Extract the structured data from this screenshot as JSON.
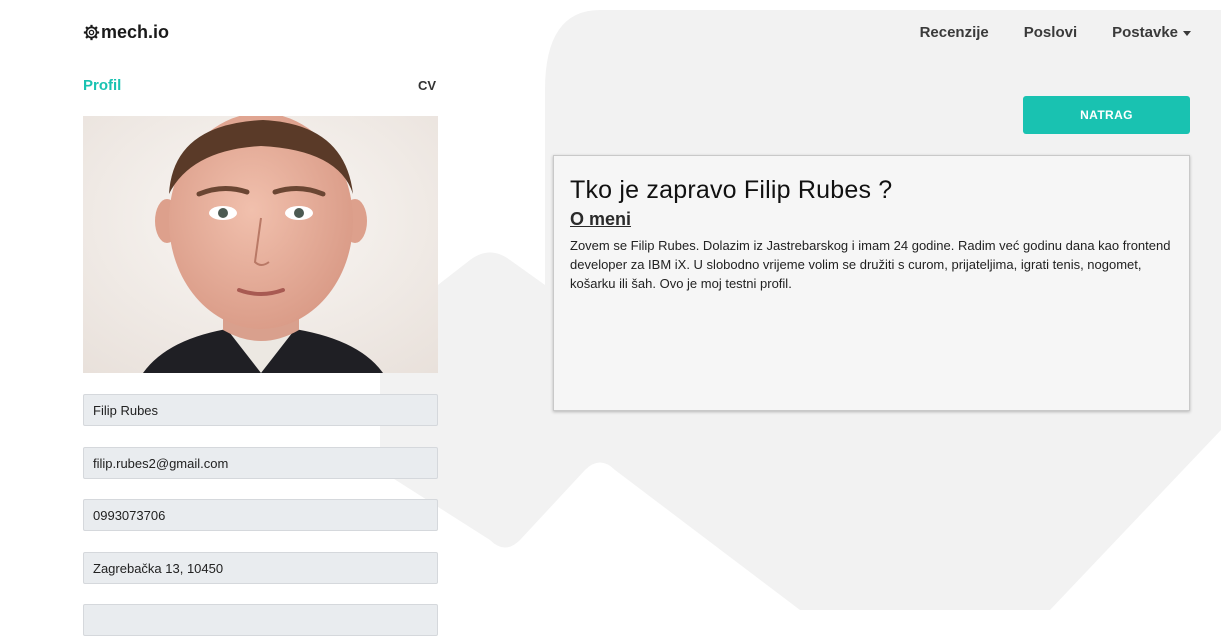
{
  "brand": {
    "name": "mech.io",
    "icon": "gear-icon"
  },
  "nav": {
    "items": [
      "Recenzije",
      "Poslovi",
      "Postavke"
    ]
  },
  "profile": {
    "tab_active": "Profil",
    "tab_cv": "CV",
    "fields": [
      "Filip Rubes",
      "filip.rubes2@gmail.com",
      "0993073706",
      "Zagrebačka 13, 10450",
      ""
    ]
  },
  "actions": {
    "back_label": "NATRAG"
  },
  "about": {
    "title": "Tko je zapravo Filip Rubes ?",
    "heading": "O meni",
    "text": "Zovem se Filip Rubes. Dolazim iz Jastrebarskog i imam 24 godine. Radim već godinu dana kao frontend developer za IBM iX. U slobodno vrijeme volim se družiti s curom, prijateljima, igrati tenis, nogomet, košarku ili šah. Ovo je moj testni profil."
  },
  "colors": {
    "accent": "#19c2b1",
    "field_bg": "#e9ecef",
    "card_bg": "#f6f6f6",
    "background_shape": "#f2f2f2"
  }
}
